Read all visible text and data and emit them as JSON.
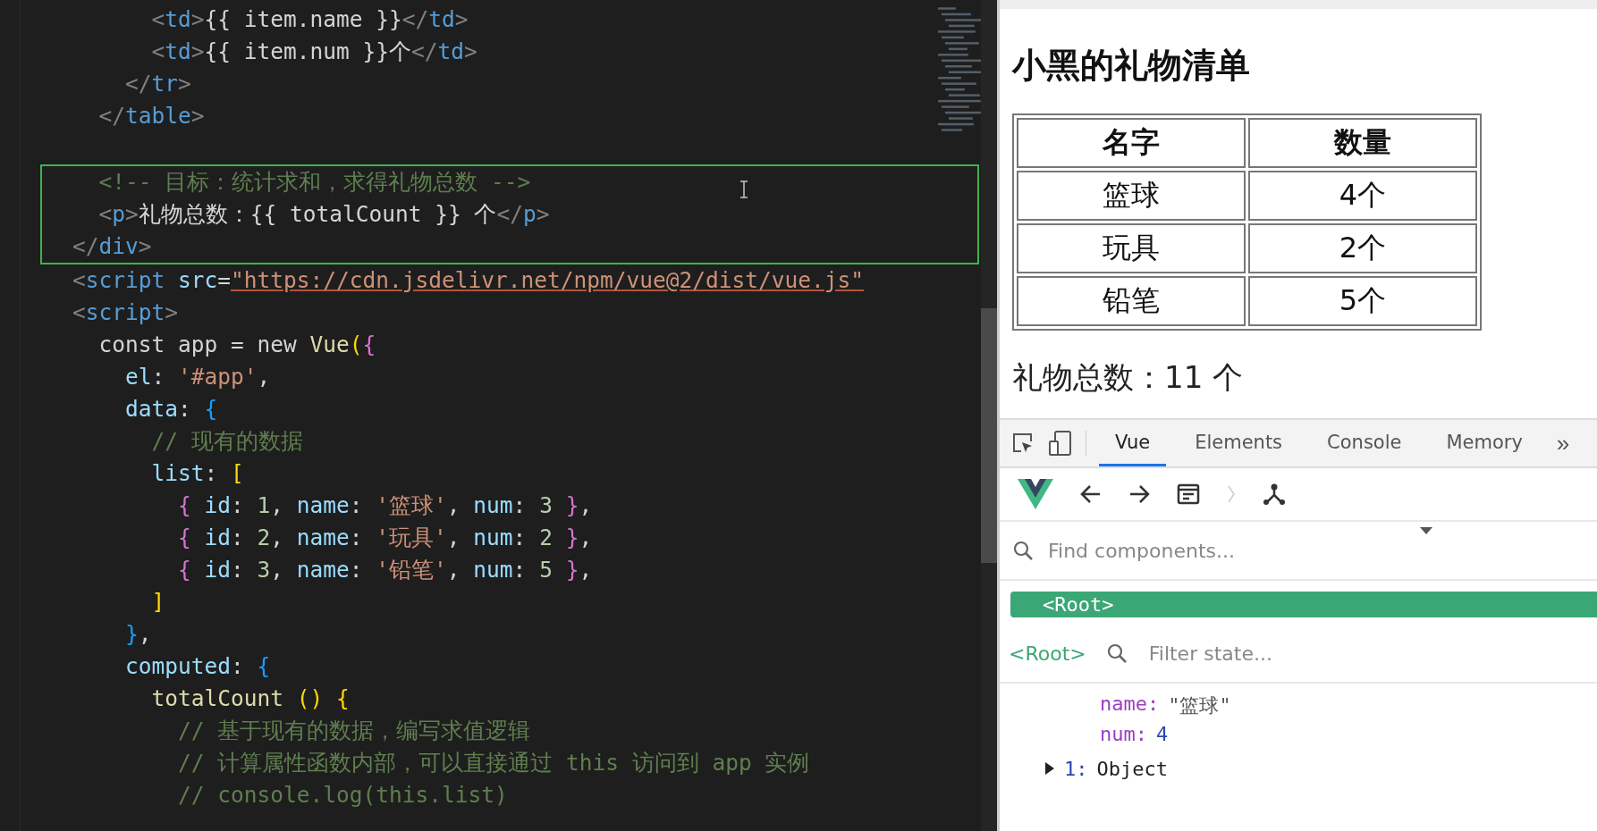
{
  "editor": {
    "lines": [
      {
        "kind": "code",
        "text": "      <td>{{ item.name }}</td>"
      },
      {
        "kind": "code",
        "text": "      <td>{{ item.num }}个</td>"
      },
      {
        "kind": "code",
        "text": "    </tr>"
      },
      {
        "kind": "code",
        "text": "  </table>"
      },
      {
        "kind": "blank"
      },
      {
        "kind": "group",
        "lines": [
          {
            "kind": "code",
            "text": "  <!-- 目标：统计求和，求得礼物总数 -->"
          },
          {
            "kind": "code",
            "text": "  <p>礼物总数：{{ totalCount }} 个</p>"
          },
          {
            "kind": "code",
            "text": "</div>"
          }
        ]
      },
      {
        "kind": "code",
        "text": "<script src=\"https://cdn.jsdelivr.net/npm/vue@2/dist/vue.js\""
      },
      {
        "kind": "code",
        "text": "<script>"
      },
      {
        "kind": "code",
        "text": "  const app = new Vue({"
      },
      {
        "kind": "code",
        "text": "    el: '#app',"
      },
      {
        "kind": "code",
        "text": "    data: {"
      },
      {
        "kind": "code",
        "text": "      // 现有的数据"
      },
      {
        "kind": "code",
        "text": "      list: ["
      },
      {
        "kind": "code",
        "text": "        { id: 1, name: '篮球', num: 3 },"
      },
      {
        "kind": "code",
        "text": "        { id: 2, name: '玩具', num: 2 },"
      },
      {
        "kind": "code",
        "text": "        { id: 3, name: '铅笔', num: 5 },"
      },
      {
        "kind": "code",
        "text": "      ]"
      },
      {
        "kind": "code",
        "text": "    },"
      },
      {
        "kind": "code",
        "text": "    computed: {"
      },
      {
        "kind": "code",
        "text": "      totalCount () {"
      },
      {
        "kind": "code",
        "text": "        // 基于现有的数据，编写求值逻辑"
      },
      {
        "kind": "code",
        "text": "        // 计算属性函数内部，可以直接通过 this 访问到 app 实例"
      },
      {
        "kind": "code",
        "text": "        // console.log(this.list)"
      }
    ]
  },
  "page": {
    "heading": "小黑的礼物清单",
    "table": {
      "columns": [
        "名字",
        "数量"
      ],
      "rows": [
        [
          "篮球",
          "4个"
        ],
        [
          "玩具",
          "2个"
        ],
        [
          "铅笔",
          "5个"
        ]
      ]
    },
    "total": "礼物总数：11 个"
  },
  "devtools": {
    "tabs": [
      {
        "label": "Vue",
        "selected": true
      },
      {
        "label": "Elements",
        "selected": false
      },
      {
        "label": "Console",
        "selected": false
      },
      {
        "label": "Memory",
        "selected": false
      }
    ],
    "more": "»",
    "find": {
      "placeholder": "Find components..."
    },
    "tree": [
      {
        "label": "<Root>",
        "selected": true
      }
    ],
    "inspector": {
      "component": "<Root>",
      "filter": {
        "placeholder": "Filter state..."
      },
      "state": [
        {
          "kind": "prop",
          "key": "name:",
          "value": "\"篮球\""
        },
        {
          "kind": "prop",
          "key": "num:",
          "value": "4"
        },
        {
          "kind": "object",
          "key": "1:",
          "value": "Object",
          "expanded": false
        }
      ]
    }
  }
}
